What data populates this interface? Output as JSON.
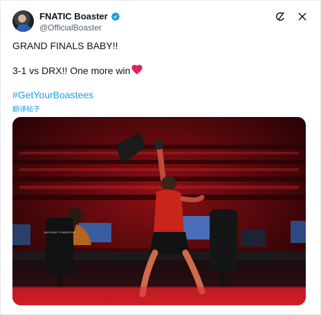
{
  "author": {
    "display_name": "FNATIC Boaster",
    "handle": "@OfficialBoaster",
    "verified_badge_icon": "verified-badge-icon"
  },
  "actions": {
    "grok_icon": "grok-icon",
    "more_icon": "more-icon"
  },
  "tweet": {
    "line1": "GRAND FINALS BABY!!",
    "line2": "3-1 vs DRX!! One more win",
    "heart_icon": "red-heart-icon",
    "hashtag": "#GetYourBoastees",
    "translate_label": "翻译帖子"
  },
  "media": {
    "description_icon": "stage-photo",
    "monitor_text": "VALORANT CHAMPIONS"
  },
  "colors": {
    "accent": "#1d9bf0",
    "heart": "#e0245e",
    "stage_red": "#b3121b"
  }
}
